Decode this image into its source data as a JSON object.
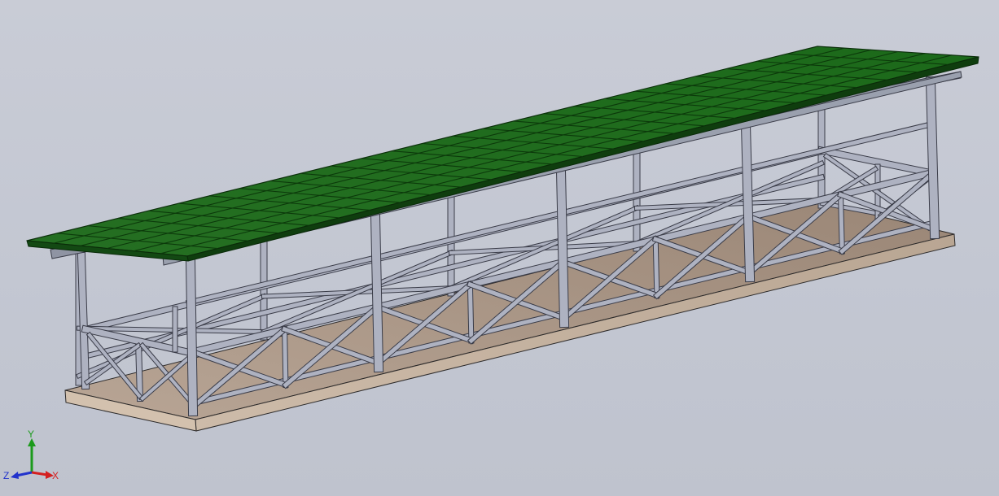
{
  "viewport": {
    "description_colors": {
      "background": "#c5c9d3",
      "roof": "#1d6a1b",
      "roof_edge": "#0f3d0e",
      "steel": "#a7abbb",
      "steel_edge": "#3a3c48",
      "deck_top": "#a69486",
      "deck_side": "#c9b6a4"
    }
  },
  "triad": {
    "x_label": "X",
    "y_label": "Y",
    "z_label": "Z",
    "x_color": "#d42020",
    "y_color": "#1c9a1c",
    "z_color": "#2233cc"
  }
}
